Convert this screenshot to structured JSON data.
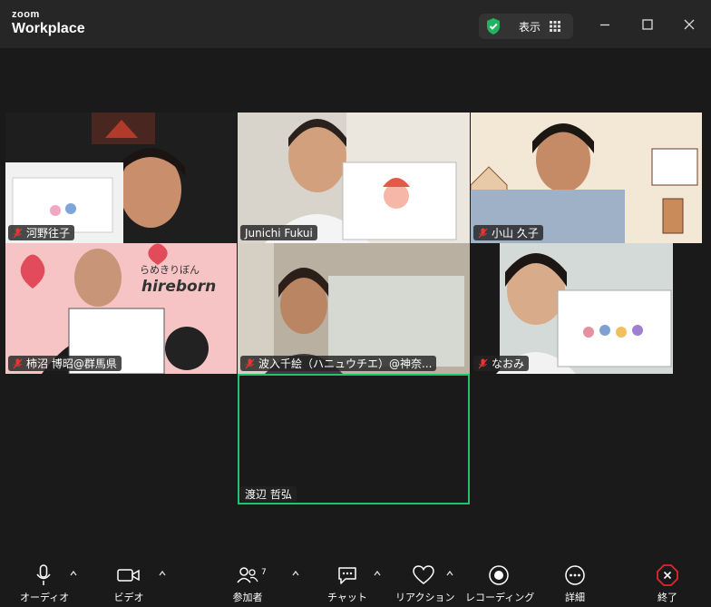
{
  "app": {
    "brand_small": "zoom",
    "brand_large": "Workplace",
    "view_label": "表示"
  },
  "participants": [
    {
      "name": "河野往子",
      "muted": true
    },
    {
      "name": "Junichi Fukui",
      "muted": false
    },
    {
      "name": "小山 久子",
      "muted": true
    },
    {
      "name": "柿沼 博昭@群馬県",
      "muted": true
    },
    {
      "name": "波入千絵（ハニュウチエ）@神奈...",
      "muted": true
    },
    {
      "name": "なおみ",
      "muted": true
    },
    {
      "name": "渡辺 哲弘",
      "muted": false,
      "active_speaker": true
    }
  ],
  "scene_text": {
    "banner_jp": "らめきりぼん",
    "banner_en": "hireborn"
  },
  "toolbar": {
    "audio": "オーディオ",
    "video": "ビデオ",
    "participants": "参加者",
    "participants_count": "7",
    "chat": "チャット",
    "reactions": "リアクション",
    "record": "レコーディング",
    "more": "詳細",
    "end": "終了"
  },
  "colors": {
    "active_speaker": "#21c36b",
    "end_button": "#e02828",
    "shield": "#22b35e"
  }
}
